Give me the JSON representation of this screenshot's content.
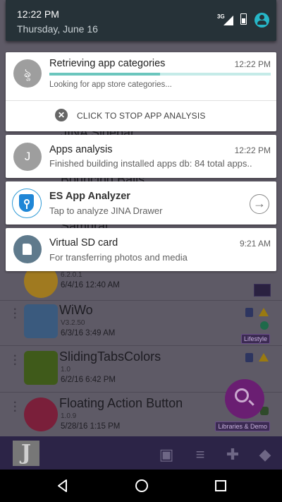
{
  "status": {
    "time": "12:22 PM",
    "date": "Thursday, June 16",
    "network": "3G"
  },
  "notifications": [
    {
      "avatar_letter": "ৡ",
      "title": "Retrieving app categories",
      "time": "12:22 PM",
      "progress": 0.5,
      "text": "Looking for app store categories...",
      "action_label": "CLICK TO STOP APP ANALYSIS",
      "colors": {
        "progress": "#6bc6bd",
        "progress_track": "#c5ebe8"
      }
    },
    {
      "avatar_letter": "J",
      "title": "Apps analysis",
      "time": "12:22 PM",
      "text": "Finished building installed apps db: 84 total apps.."
    },
    {
      "icon": "shield-icon",
      "title": "ES App Analyzer",
      "text": "Tap to analyze JINA Drawer",
      "action_icon": "arrow-right-icon"
    },
    {
      "icon": "sd-card-icon",
      "title": "Virtual SD card",
      "time": "9:21 AM",
      "text": "For transferring photos and media"
    }
  ],
  "background_app": {
    "partial_names": [
      "JINA Sidebar",
      "Bouncing Balls",
      "Samurai"
    ],
    "rows": [
      {
        "name": "",
        "version": "6.2.0.1",
        "date": "6/4/16 12:40 AM"
      },
      {
        "name": "WiWo",
        "version": "V3.2.50",
        "date": "6/3/16 3:49 AM",
        "tag": "Lifestyle"
      },
      {
        "name": "SlidingTabsColors",
        "version": "1.0",
        "date": "6/2/16 6:42 PM"
      },
      {
        "name": "Floating Action Button",
        "version": "1.0.9",
        "date": "5/28/16 1:15 PM",
        "tag": "Libraries & Demo"
      }
    ],
    "bottom_bar_logo": "J"
  },
  "colors": {
    "shade": "#263238",
    "accent": "#26b6c7",
    "fab": "#6a1e72",
    "bottom_bar": "#2c2447"
  }
}
